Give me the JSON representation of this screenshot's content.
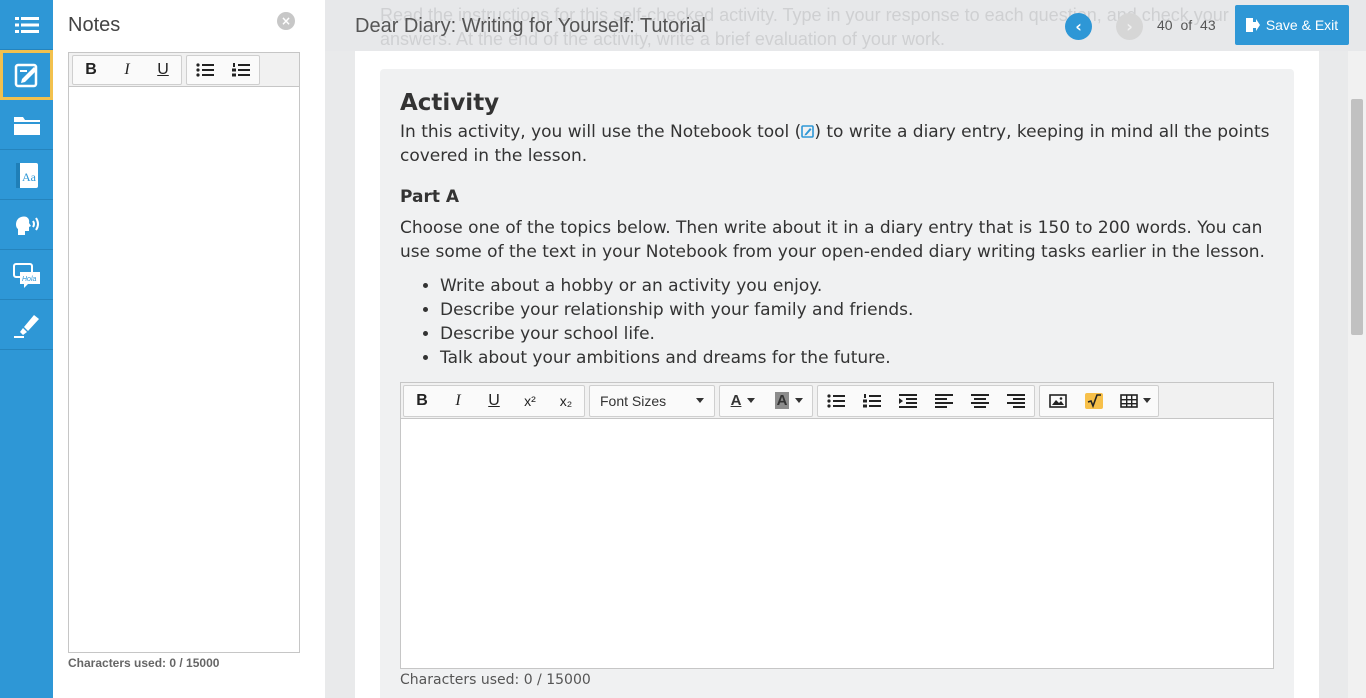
{
  "rail": {
    "items": [
      {
        "name": "menu",
        "icon": "hamburger-list-icon",
        "active": false
      },
      {
        "name": "notebook",
        "icon": "notebook-edit-icon",
        "active": true
      },
      {
        "name": "folder",
        "icon": "folder-icon",
        "active": false
      },
      {
        "name": "glossary",
        "icon": "dictionary-aa-icon",
        "active": false
      },
      {
        "name": "text-to-speech",
        "icon": "speaking-head-icon",
        "active": false
      },
      {
        "name": "translate",
        "icon": "hola-speech-bubble-icon",
        "active": false
      },
      {
        "name": "highlighter",
        "icon": "highlighter-icon",
        "active": false
      }
    ]
  },
  "notes": {
    "title": "Notes",
    "close_symbol": "×",
    "toolbar": {
      "bold": "B",
      "italic": "I",
      "underline": "U"
    },
    "char_count": "Characters used: 0 / 15000"
  },
  "header": {
    "background_text": "Read the instructions for this self-checked activity. Type in your response to each question, and check your answers. At the end of the activity, write a brief evaluation of your work.",
    "title": "Dear Diary: Writing for Yourself: Tutorial",
    "prev_symbol": "‹",
    "next_symbol": "›",
    "page_counter": "40 of 43",
    "save_exit_label": "Save & Exit"
  },
  "activity": {
    "title": "Activity",
    "intro_before": "In this activity, you will use the Notebook tool (",
    "intro_after": ") to write a diary entry, keeping in mind all the points covered in the lesson.",
    "part_title": "Part A",
    "part_text": "Choose one of the topics below. Then write about it in a diary entry that is 150 to 200 words. You can use some of the text in your Notebook from your open-ended diary writing tasks earlier in the lesson.",
    "topics": [
      "Write about a hobby or an activity you enjoy.",
      "Describe your relationship with your family and friends.",
      "Describe your school life.",
      "Talk about your ambitions and dreams for the future."
    ]
  },
  "editor": {
    "toolbar": {
      "bold": "B",
      "italic": "I",
      "underline": "U",
      "superscript": "x²",
      "subscript": "x₂",
      "font_sizes": "Font Sizes",
      "font_color": "A",
      "bg_color": "A"
    },
    "char_count": "Characters used: 0 / 15000"
  },
  "colors": {
    "accent": "#2e97d6",
    "active_outline": "#f2c14e",
    "card_bg": "#f0f1f2"
  }
}
